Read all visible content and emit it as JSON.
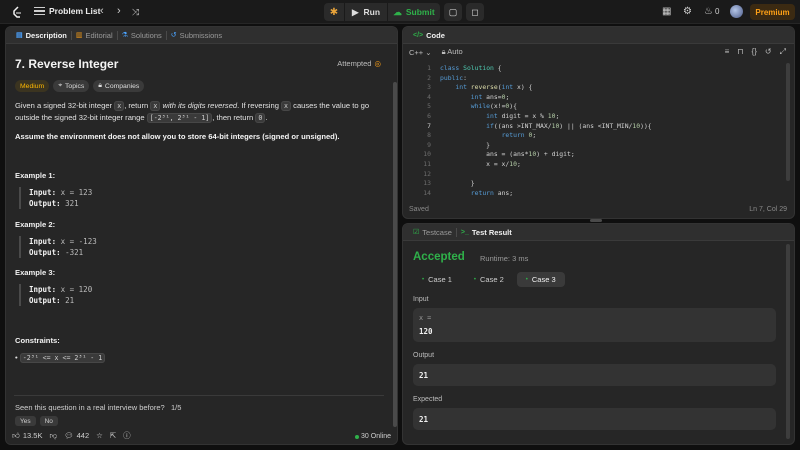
{
  "topbar": {
    "problem_list": "Problem List",
    "run": "Run",
    "submit": "Submit",
    "notif_count": "0",
    "premium": "Premium"
  },
  "left": {
    "tabs": [
      "Description",
      "Editorial",
      "Solutions",
      "Submissions"
    ],
    "title": "7. Reverse Integer",
    "status": "Attempted",
    "badges": [
      "Medium",
      "Topics",
      "Companies"
    ],
    "desc": {
      "p1a": "Given a signed 32-bit integer ",
      "x": "x",
      "p1b": ", return ",
      "p1c": "x",
      "p1d": " with its digits reversed",
      "p1e": ". If reversing ",
      "p1f": "x",
      "p1g": " causes the value to go outside the signed 32-bit integer range ",
      "range": "[-2³¹, 2³¹ - 1]",
      "p1h": ", then return ",
      "zero": "0",
      "p1i": ".",
      "p2": "Assume the environment does not allow you to store 64-bit integers (signed or unsigned)."
    },
    "examples": [
      {
        "title": "Example 1:",
        "input_label": "Input:",
        "input": "x = 123",
        "output_label": "Output:",
        "output": "321"
      },
      {
        "title": "Example 2:",
        "input_label": "Input:",
        "input": "x = -123",
        "output_label": "Output:",
        "output": "-321"
      },
      {
        "title": "Example 3:",
        "input_label": "Input:",
        "input": "x = 120",
        "output_label": "Output:",
        "output": "21"
      }
    ],
    "constraints_title": "Constraints:",
    "constraint": "-2³¹ <= x <= 2³¹ - 1",
    "seen_q": "Seen this question in a real interview before?",
    "seen_count": "1/5",
    "yes": "Yes",
    "no": "No",
    "likes": "13.5K",
    "comments": "442",
    "online": "30 Online"
  },
  "code": {
    "tab": "Code",
    "lang": "C++",
    "auto": "Auto",
    "saved": "Saved",
    "cursor": "Ln 7, Col 29",
    "line_numbers": [
      "1",
      "2",
      "3",
      "4",
      "5",
      "6",
      "7",
      "8",
      "9",
      "10",
      "11",
      "12",
      "13",
      "14"
    ]
  },
  "test": {
    "tab_testcase": "Testcase",
    "tab_result": "Test Result",
    "verdict": "Accepted",
    "runtime": "Runtime: 3 ms",
    "cases": [
      "Case 1",
      "Case 2",
      "Case 3"
    ],
    "input_label": "Input",
    "input_key": "x =",
    "input_val": "120",
    "output_label": "Output",
    "output_val": "21",
    "expected_label": "Expected",
    "expected_val": "21"
  },
  "colors": {
    "accent": "#ffa116",
    "success": "#2fb14a"
  }
}
